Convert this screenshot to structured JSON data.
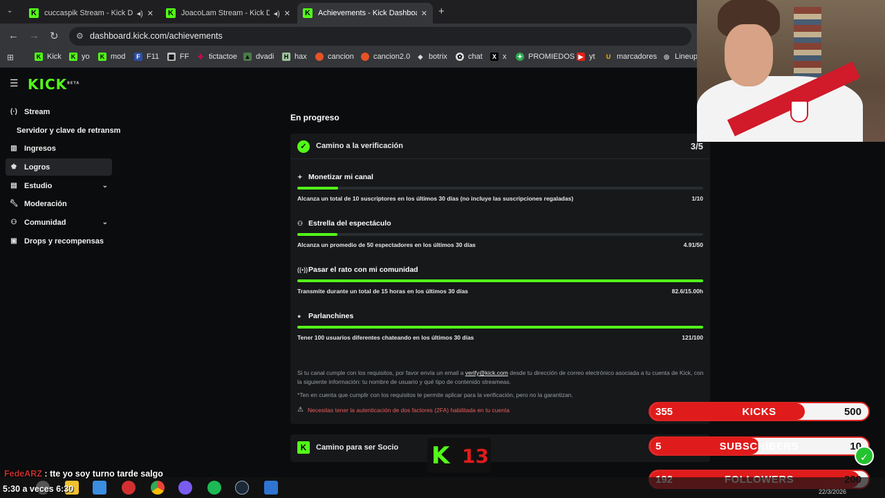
{
  "browser": {
    "tabs": [
      {
        "title": "cuccaspik Stream - Kick Da",
        "icon": "kick-favicon",
        "audio": true
      },
      {
        "title": "JoacoLam Stream - Kick Da",
        "icon": "kick-favicon",
        "audio": true
      },
      {
        "title": "Achievements - Kick Dashboard",
        "icon": "kick-favicon",
        "audio": false
      }
    ],
    "new_tab": "+",
    "url": "dashboard.kick.com/achievements",
    "bookmarks": [
      "Kick",
      "yo",
      "mod",
      "F11",
      "FF",
      "tictactoe",
      "dvadi",
      "hax",
      "cancion",
      "cancion2.0",
      "botrix",
      "chat",
      "x",
      "PROMIEDOS",
      "yt",
      "marcadores",
      "Lineup"
    ]
  },
  "sidebar": {
    "logo": "KICK",
    "logo_tag": "BETA",
    "items": [
      {
        "label": "Stream",
        "icon": "broadcast-icon"
      },
      {
        "label": "Servidor y clave de retransm",
        "icon": ""
      },
      {
        "label": "Ingresos",
        "icon": "chart-icon"
      },
      {
        "label": "Logros",
        "icon": "trophy-icon",
        "active": true
      },
      {
        "label": "Estudio",
        "icon": "studio-icon",
        "expandable": true
      },
      {
        "label": "Moderación",
        "icon": "wrench-icon"
      },
      {
        "label": "Comunidad",
        "icon": "community-icon",
        "expandable": true
      },
      {
        "label": "Drops y recompensas",
        "icon": "gift-icon"
      }
    ]
  },
  "main": {
    "section_title": "En progreso",
    "card": {
      "title": "Camino a la verificación",
      "count": "3/5",
      "requirements": [
        {
          "title": "Monetizar mi canal",
          "icon": "sparkle-icon",
          "desc": "Alcanza un total de 10 suscriptores en los últimos 30 días (no incluye las suscripciones regaladas)",
          "value": "1/10",
          "progress": 0.1
        },
        {
          "title": "Estrella del espectáculo",
          "icon": "viewers-icon",
          "desc": "Alcanza un promedio de 50 espectadores en los últimos 30 días",
          "value": "4.91/50",
          "progress": 0.098
        },
        {
          "title": "Pasar el rato con mi comunidad",
          "icon": "signal-icon",
          "desc": "Transmite durante un total de 15 horas en los últimos 30 días",
          "value": "82.6/15.00h",
          "progress": 1.0
        },
        {
          "title": "Parlanchines",
          "icon": "chat-bubble-icon",
          "desc": "Tener 100 usuarios diferentes chateando en los últimos 30 días",
          "value": "121/100",
          "progress": 1.0
        }
      ],
      "info_pre": "Si tu canal cumple con los requisitos, por favor envía un email a ",
      "info_link": "verify@kick.com",
      "info_post": " desde tu dirección de correo electrónico asociada a tu cuenta de Kick, con la siguiente información: tu nombre de usuario y qué tipo de contenido streameas.",
      "note": "*Ten en cuenta que cumplir con los requisitos te permite aplicar para la verificación, pero no la garantizan.",
      "warning": "Necesitas tener la autenticación de dos factores (2FA) habilitada en tu cuenta"
    },
    "card2": {
      "title": "Camino para ser Socio"
    }
  },
  "overlay": {
    "goals": [
      {
        "current": "355",
        "label": "KICKS",
        "target": "500",
        "progress": 0.71
      },
      {
        "current": "5",
        "label": "SUBSCRIBERS",
        "target": "10",
        "progress": 0.5
      },
      {
        "current": "192",
        "label": "FOLLOWERS",
        "target": "200",
        "progress": 0.96
      }
    ],
    "chat_user": "FedeARZ",
    "chat_text": " : tte yo soy turno tarde salgo",
    "clock_text": "5:30 a veces 6:30",
    "logo_k": "K",
    "logo_num": "13",
    "date": "22/3/2026"
  },
  "colors": {
    "accent": "#53fc18",
    "warning": "#f25c5c",
    "overlay_red": "#e01b1b"
  }
}
